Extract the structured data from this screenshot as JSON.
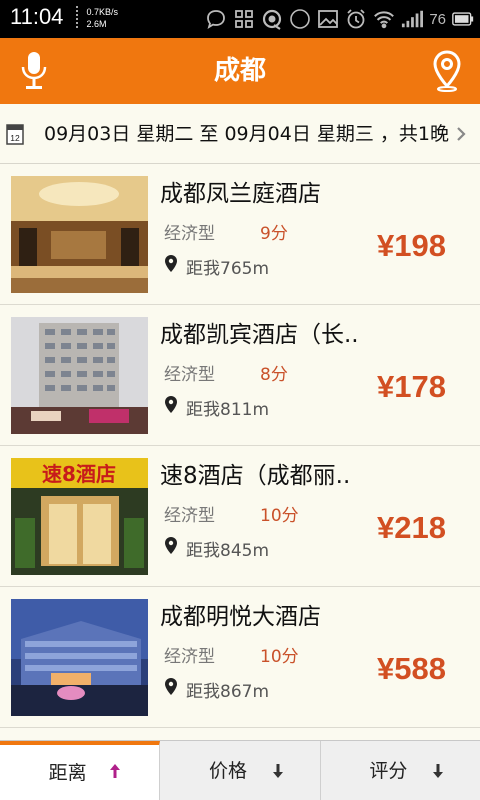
{
  "status_bar": {
    "time": "11:04",
    "net_speed": "0.7KB/s",
    "net_total": "2.6M",
    "badge": "76",
    "battery": "76"
  },
  "header": {
    "title": "成都",
    "left_icon": "microphone-icon",
    "right_icon": "location-pin-icon"
  },
  "date_bar": {
    "text": "09月03日 星期二 至 09月04日 星期三 ，共1晚",
    "icon": "calendar-icon",
    "calendar_day": "12"
  },
  "hotels": [
    {
      "name": "成都凤兰庭酒店",
      "type": "经济型",
      "score": "9分",
      "distance": "距我765m",
      "price": "¥198"
    },
    {
      "name": "成都凯宾酒店（长..",
      "type": "经济型",
      "score": "8分",
      "distance": "距我811m",
      "price": "¥178"
    },
    {
      "name": "速8酒店（成都丽..",
      "type": "经济型",
      "score": "10分",
      "distance": "距我845m",
      "price": "¥218",
      "sign_text": "速8酒店"
    },
    {
      "name": "成都明悦大酒店",
      "type": "经济型",
      "score": "10分",
      "distance": "距我867m",
      "price": "¥588"
    }
  ],
  "sort_tabs": [
    {
      "label": "距离",
      "arrow": "up",
      "active": true
    },
    {
      "label": "价格",
      "arrow": "down",
      "active": false
    },
    {
      "label": "评分",
      "arrow": "down",
      "active": false
    }
  ],
  "colors": {
    "accent": "#f0770f",
    "price": "#d24f22",
    "active_arrow": "#b0208a"
  }
}
